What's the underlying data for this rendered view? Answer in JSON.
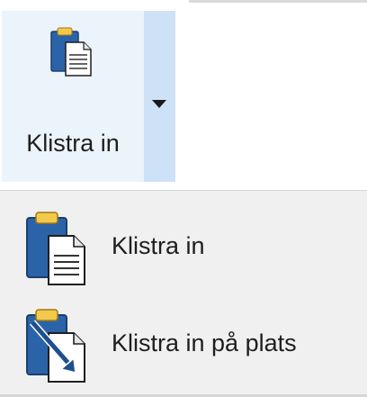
{
  "split_button": {
    "label": "Klistra in",
    "icon": "clipboard-paste-icon",
    "dropdown_icon": "dropdown-triangle-icon"
  },
  "menu": {
    "items": [
      {
        "label": "Klistra in",
        "icon": "clipboard-paste-icon"
      },
      {
        "label": "Klistra in på plats",
        "icon": "paste-in-place-icon"
      }
    ]
  },
  "colors": {
    "button_bg": "#ebf3fb",
    "arrow_bg": "#cde1f7",
    "menu_bg": "#f0f0f0",
    "clipboard_blue": "#2b63a8",
    "clip_gold": "#f2c94c"
  }
}
